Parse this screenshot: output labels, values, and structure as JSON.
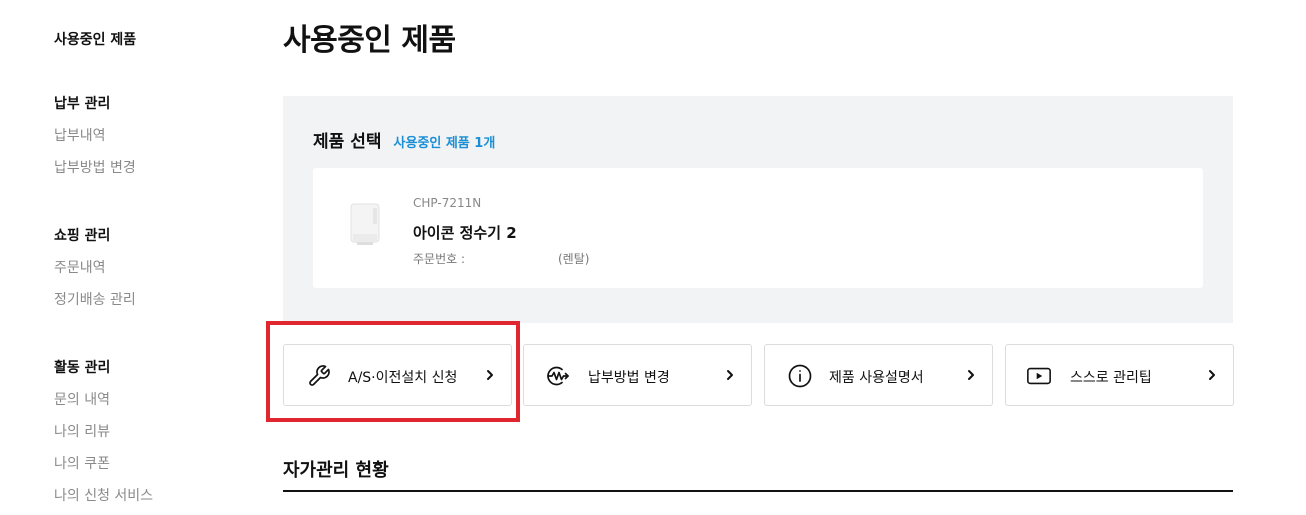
{
  "sidebar": {
    "top_link": "사용중인 제품",
    "sections": [
      {
        "heading": "납부 관리",
        "items": [
          "납부내역",
          "납부방법 변경"
        ]
      },
      {
        "heading": "쇼핑 관리",
        "items": [
          "주문내역",
          "정기배송 관리"
        ]
      },
      {
        "heading": "활동 관리",
        "items": [
          "문의 내역",
          "나의 리뷰",
          "나의 쿠폰",
          "나의 신청 서비스"
        ]
      }
    ]
  },
  "page": {
    "title": "사용중인 제품"
  },
  "product_select": {
    "title": "제품 선택",
    "count_label": "사용중인 제품 1개",
    "product": {
      "model": "CHP-7211N",
      "name": "아이콘 정수기 2",
      "order_label": "주문번호 :",
      "order_type": "(렌탈)"
    }
  },
  "actions": [
    {
      "label": "A/S·이전설치 신청",
      "icon": "wrench-icon"
    },
    {
      "label": "납부방법 변경",
      "icon": "payment-icon"
    },
    {
      "label": "제품 사용설명서",
      "icon": "info-icon"
    },
    {
      "label": "스스로 관리팁",
      "icon": "play-icon"
    }
  ],
  "section": {
    "title": "자가관리 현황"
  },
  "colors": {
    "accent": "#1a8fd6",
    "highlight": "#e0262f",
    "panel_bg": "#f2f3f5"
  }
}
